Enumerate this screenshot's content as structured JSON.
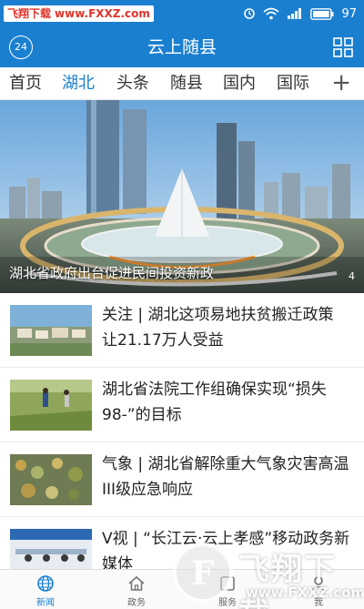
{
  "status_bar": {
    "watermark_name": "飞翔下载",
    "watermark_url": "www.FXXZ.com",
    "battery_level": "97"
  },
  "header": {
    "title": "云上随县",
    "weather_badge": "24"
  },
  "tabs": [
    {
      "label": "首页",
      "active": false
    },
    {
      "label": "湖北",
      "active": true
    },
    {
      "label": "头条",
      "active": false
    },
    {
      "label": "随县",
      "active": false
    },
    {
      "label": "国内",
      "active": false
    },
    {
      "label": "国际",
      "active": false
    }
  ],
  "tab_add_label": "+",
  "hero": {
    "caption": "湖北省政府出台促进民间投资新政",
    "slide_count": "4"
  },
  "news": [
    {
      "title": "关注 | 湖北这项易地扶贫搬迁政策 让21.17万人受益",
      "thumb_icon": "village-photo"
    },
    {
      "title": "湖北省法院工作组确保实现“损失98-”的目标",
      "thumb_icon": "field-photo"
    },
    {
      "title": "气象 | 湖北省解除重大气象灾害高温III级应急响应",
      "thumb_icon": "crops-photo"
    },
    {
      "title": "V视 | “长江云·云上孝感”移动政务新媒体",
      "thumb_icon": "meeting-photo"
    }
  ],
  "bottom_tabs": [
    {
      "label": "新闻",
      "icon": "globe-icon",
      "active": true
    },
    {
      "label": "政务",
      "icon": "home-icon",
      "active": false
    },
    {
      "label": "服务",
      "icon": "service-icon",
      "active": false
    },
    {
      "label": "我",
      "icon": "user-icon",
      "active": false
    }
  ],
  "colors": {
    "brand_blue": "#1b7fd0",
    "text": "#222222"
  },
  "bottom_watermark": {
    "name": "飞翔下载",
    "url": "www.FXXZ.com"
  }
}
